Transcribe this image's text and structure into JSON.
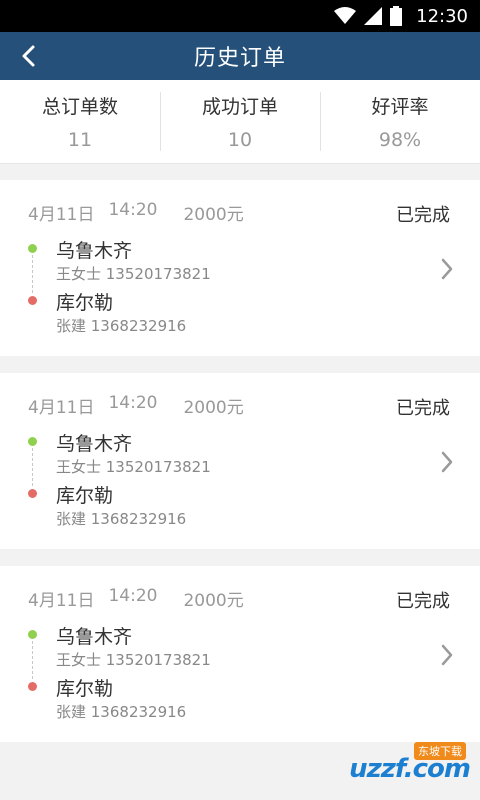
{
  "status_bar": {
    "time": "12:30"
  },
  "header": {
    "title": "历史订单"
  },
  "stats": [
    {
      "label": "总订单数",
      "value": "11"
    },
    {
      "label": "成功订单",
      "value": "10"
    },
    {
      "label": "好评率",
      "value": "98%"
    }
  ],
  "orders": [
    {
      "date": "4月11日",
      "time": "14:20",
      "price": "2000元",
      "status": "已完成",
      "from_city": "乌鲁木齐",
      "from_person": "王女士 13520173821",
      "to_city": "库尔勒",
      "to_person": "张建 1368232916"
    },
    {
      "date": "4月11日",
      "time": "14:20",
      "price": "2000元",
      "status": "已完成",
      "from_city": "乌鲁木齐",
      "from_person": "王女士 13520173821",
      "to_city": "库尔勒",
      "to_person": "张建 1368232916"
    },
    {
      "date": "4月11日",
      "time": "14:20",
      "price": "2000元",
      "status": "已完成",
      "from_city": "乌鲁木齐",
      "from_person": "王女士 13520173821",
      "to_city": "库尔勒",
      "to_person": "张建 1368232916"
    }
  ],
  "watermark": {
    "text": "uzzf.com",
    "sub": "东坡下载"
  },
  "colors": {
    "header_bg": "#24507a",
    "origin_dot": "#8fd14f",
    "destination_dot": "#e56c66"
  }
}
